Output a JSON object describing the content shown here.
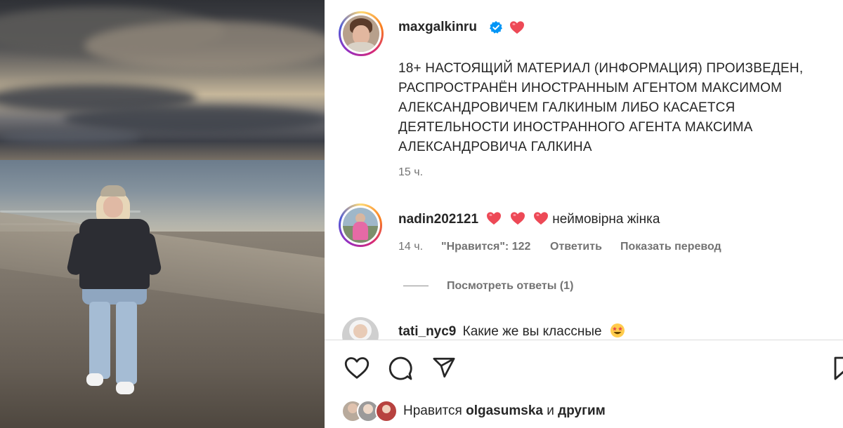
{
  "post": {
    "author": "maxgalkinru",
    "caption": "18+ НАСТОЯЩИЙ МАТЕРИАЛ (ИНФОРМАЦИЯ) ПРОИЗВЕДЕН,\nРАСПРОСТРАНЁН ИНОСТРАННЫМ АГЕНТОМ МАКСИМОМ\nАЛЕКСАНДРОВИЧЕМ ГАЛКИНЫМ ЛИБО КАСАЕТСЯ\nДЕЯТЕЛЬНОСТИ ИНОСТРАННОГО АГЕНТА МАКСИМА\nАЛЕКСАНДРОВИЧА ГАЛКИНА",
    "time": "15 ч."
  },
  "comments": [
    {
      "user": "nadin202121",
      "text": "неймовірна жінка",
      "time": "14 ч.",
      "likes_label": "\"Нравится\": 122",
      "reply_label": "Ответить",
      "translate_label": "Показать перевод",
      "view_replies_label": "Посмотреть ответы (1)"
    },
    {
      "user": "tati_nyc9",
      "text": "Какие же вы классные"
    }
  ],
  "likes": {
    "prefix": "Нравится",
    "user": "olgasumska",
    "conj": "и",
    "suffix": "другим"
  },
  "icons": [
    "verified-badge-icon",
    "heart-emoji-icon",
    "like-icon",
    "comment-icon",
    "share-icon",
    "save-icon"
  ],
  "colors": {
    "verified": "#0095f6",
    "heart": "#ed4956",
    "text": "#262626",
    "muted": "#737373"
  }
}
